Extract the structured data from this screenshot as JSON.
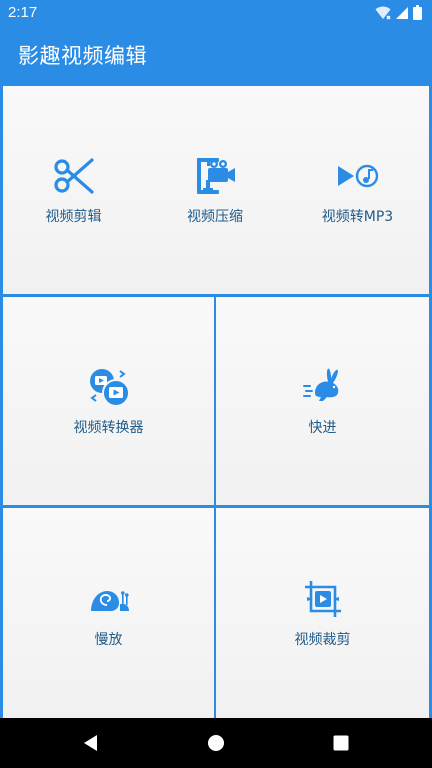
{
  "status_bar": {
    "time": "2:17",
    "icons": [
      "wifi-icon",
      "signal-icon",
      "battery-icon"
    ]
  },
  "app_bar": {
    "title": "影趣视频编辑"
  },
  "tiles": [
    {
      "label": "视频剪辑",
      "icon": "scissors-icon"
    },
    {
      "label": "视频压缩",
      "icon": "compress-clamp-icon"
    },
    {
      "label": "视频转MP3",
      "icon": "video-to-mp3-icon"
    },
    {
      "label": "视频转换器",
      "icon": "video-converter-icon"
    },
    {
      "label": "快进",
      "icon": "rabbit-icon"
    },
    {
      "label": "慢放",
      "icon": "snail-icon"
    },
    {
      "label": "视频裁剪",
      "icon": "crop-video-icon"
    }
  ],
  "navigation": {
    "buttons": [
      "back-icon",
      "home-icon",
      "recents-icon"
    ]
  },
  "colors": {
    "primary": "#2b8ce6",
    "label": "#1f5b8a",
    "icon": "#2b8ce6"
  }
}
